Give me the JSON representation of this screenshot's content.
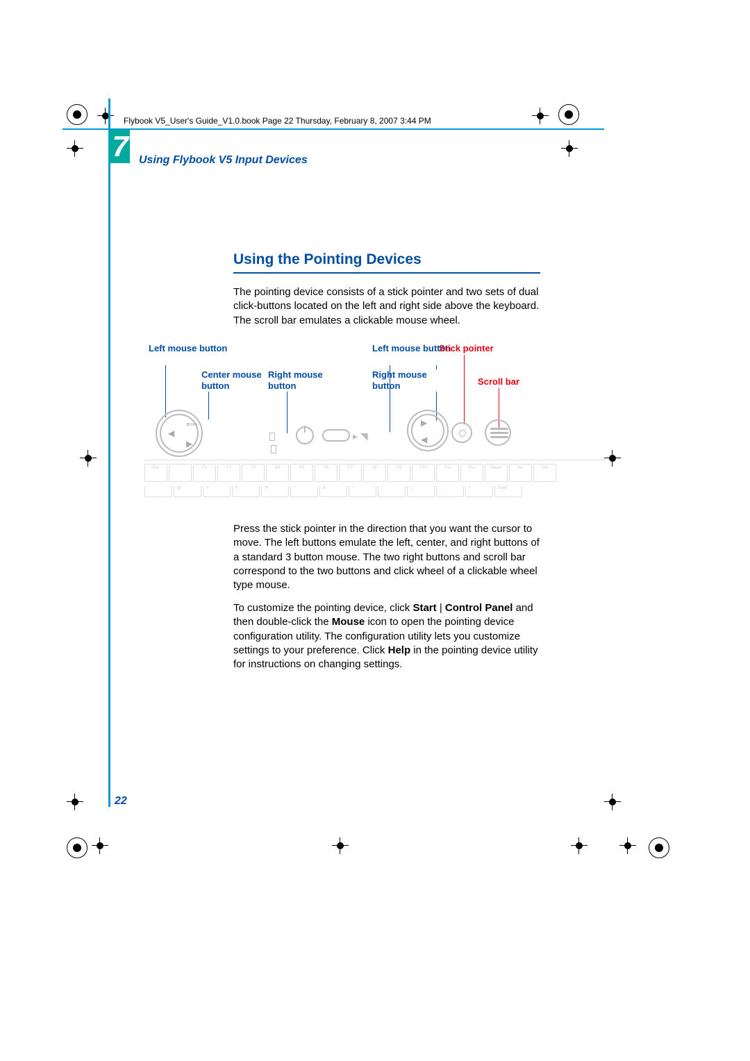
{
  "header": {
    "running": "Flybook V5_User's Guide_V1.0.book  Page 22  Thursday, February 8, 2007  3:44 PM"
  },
  "chapter": {
    "number": "7",
    "title": "Using Flybook V5 Input Devices"
  },
  "section": {
    "title": "Using the Pointing Devices"
  },
  "paragraphs": {
    "p1": "The pointing device consists of a stick pointer and two sets of dual click-buttons located on the left and right side above the keyboard. The scroll bar emulates a clickable mouse wheel.",
    "p2": "Press the stick pointer in the direction that you want the cursor to move. The left buttons emulate the left, center, and right buttons of a standard 3 button mouse. The two right buttons and scroll bar correspond to the two buttons and click wheel of a clickable wheel type mouse.",
    "p3_a": "To customize the pointing device, click ",
    "p3_b1": "Start",
    "p3_sep": " | ",
    "p3_b2": "Control Panel",
    "p3_c": " and then double-click the ",
    "p3_b3": "Mouse",
    "p3_d": " icon to open the pointing device configuration utility. The configuration utility lets you customize settings to your preference. Click ",
    "p3_b4": "Help",
    "p3_e": " in the pointing device utility for instructions on changing settings."
  },
  "diagram": {
    "left_mouse_button": "Left mouse button",
    "center_mouse_button": "Center mouse button",
    "right_mouse_button": "Right mouse button",
    "left_mouse_button2": "Left mouse button",
    "right_mouse_button2": "Right mouse button",
    "stick_pointer": "Stick pointer",
    "scroll_bar": "Scroll bar"
  },
  "keys_row1": [
    "Esc",
    "",
    "F1",
    "F2",
    "F3",
    "F4",
    "F5",
    "F6",
    "F7",
    "F8",
    "F9",
    "F10",
    "F11",
    "F12",
    "Pause",
    "Ins",
    "Del"
  ],
  "keys_row2": [
    "!",
    "@",
    "#",
    "$",
    "%",
    "^",
    "&",
    "*",
    "(",
    ")",
    "_",
    "+",
    "Back"
  ],
  "page_number": "22"
}
